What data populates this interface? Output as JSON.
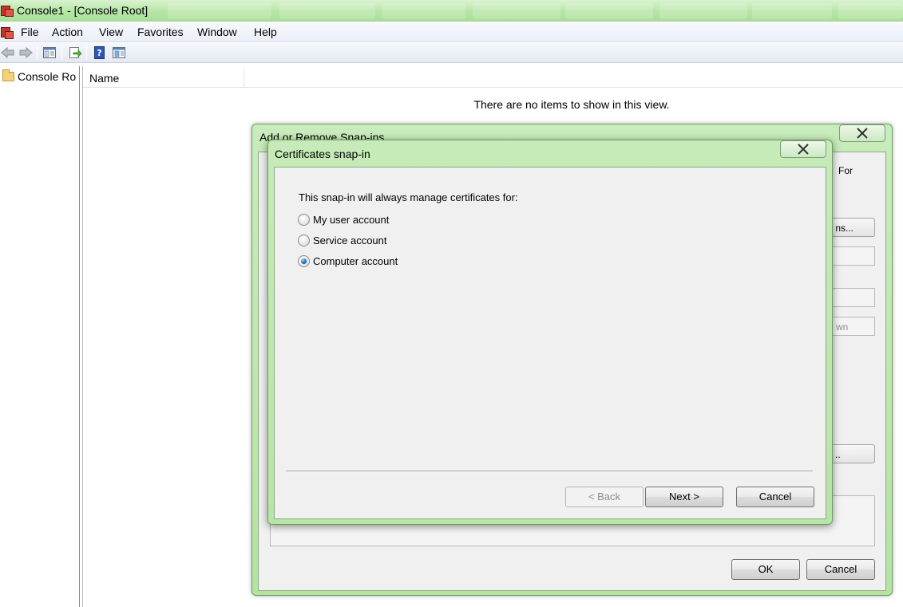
{
  "window": {
    "title": "Console1 - [Console Root]"
  },
  "menu": {
    "items": [
      "File",
      "Action",
      "View",
      "Favorites",
      "Window",
      "Help"
    ]
  },
  "toolbar": {
    "buttons": [
      "back-arrow-icon",
      "forward-arrow-icon",
      "show-hide-console-tree-icon",
      "export-list-icon",
      "help-icon",
      "show-hide-action-pane-icon"
    ]
  },
  "tree": {
    "root_label": "Console Ro"
  },
  "list": {
    "column_name": "Name",
    "empty_message": "There are no items to show in this view."
  },
  "outer_dialog": {
    "title": "Add or Remove Snap-ins",
    "partial_for": "For",
    "partial_extensions": "ns...",
    "partial_move_down": "wn",
    "partial_advanced": "..",
    "ok_label": "OK",
    "cancel_label": "Cancel"
  },
  "inner_dialog": {
    "title": "Certificates snap-in",
    "instruction": "This snap-in will always manage certificates for:",
    "options": [
      {
        "label": "My user account",
        "checked": false
      },
      {
        "label": "Service account",
        "checked": false
      },
      {
        "label": "Computer account",
        "checked": true
      }
    ],
    "back_label": "< Back",
    "next_label": "Next >",
    "cancel_label": "Cancel"
  },
  "colors": {
    "aero_glass": "#b4e3a3",
    "dialog_client": "#f0f0f0",
    "radio_selected": "#1b6fbf"
  }
}
